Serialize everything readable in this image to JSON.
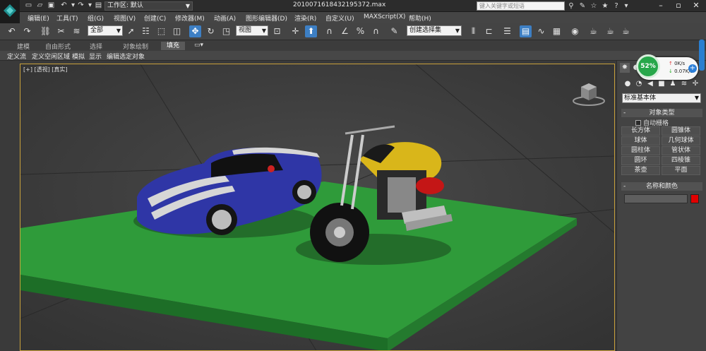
{
  "titlebar": {
    "workspace_label": "工作区: 默认",
    "document_title": "2010071618432195372.max",
    "search_placeholder": "键入关键字或短语"
  },
  "menu": [
    "编辑(E)",
    "工具(T)",
    "组(G)",
    "视图(V)",
    "创建(C)",
    "修改器(M)",
    "动画(A)",
    "图形编辑器(D)",
    "渲染(R)",
    "自定义(U)",
    "MAXScript(X)",
    "帮助(H)"
  ],
  "toolbar": {
    "selection_filter": "全部",
    "reference_coord": "视图",
    "named_selection": "创建选择集"
  },
  "ribbon": {
    "tabs": [
      "建模",
      "自由形式",
      "选择",
      "对象绘制",
      "填充"
    ],
    "active_tab": "填充"
  },
  "subbar": [
    "定义流",
    "定义空闲区域",
    "模拟",
    "显示",
    "编辑选定对象"
  ],
  "viewport": {
    "label": "[+] [透视] [真实]"
  },
  "command_panel": {
    "category": "标准基本体",
    "object_type_header": "对象类型",
    "auto_grid": "自动栅格",
    "object_buttons": [
      "长方体",
      "圆锥体",
      "球体",
      "几何球体",
      "圆柱体",
      "管状体",
      "圆环",
      "四棱锥",
      "茶壶",
      "平面"
    ],
    "name_color_header": "名称和颜色",
    "object_color": "#e00000"
  },
  "network_widget": {
    "percent": "52%",
    "upload": "0K/s",
    "download": "0.07K/s"
  }
}
